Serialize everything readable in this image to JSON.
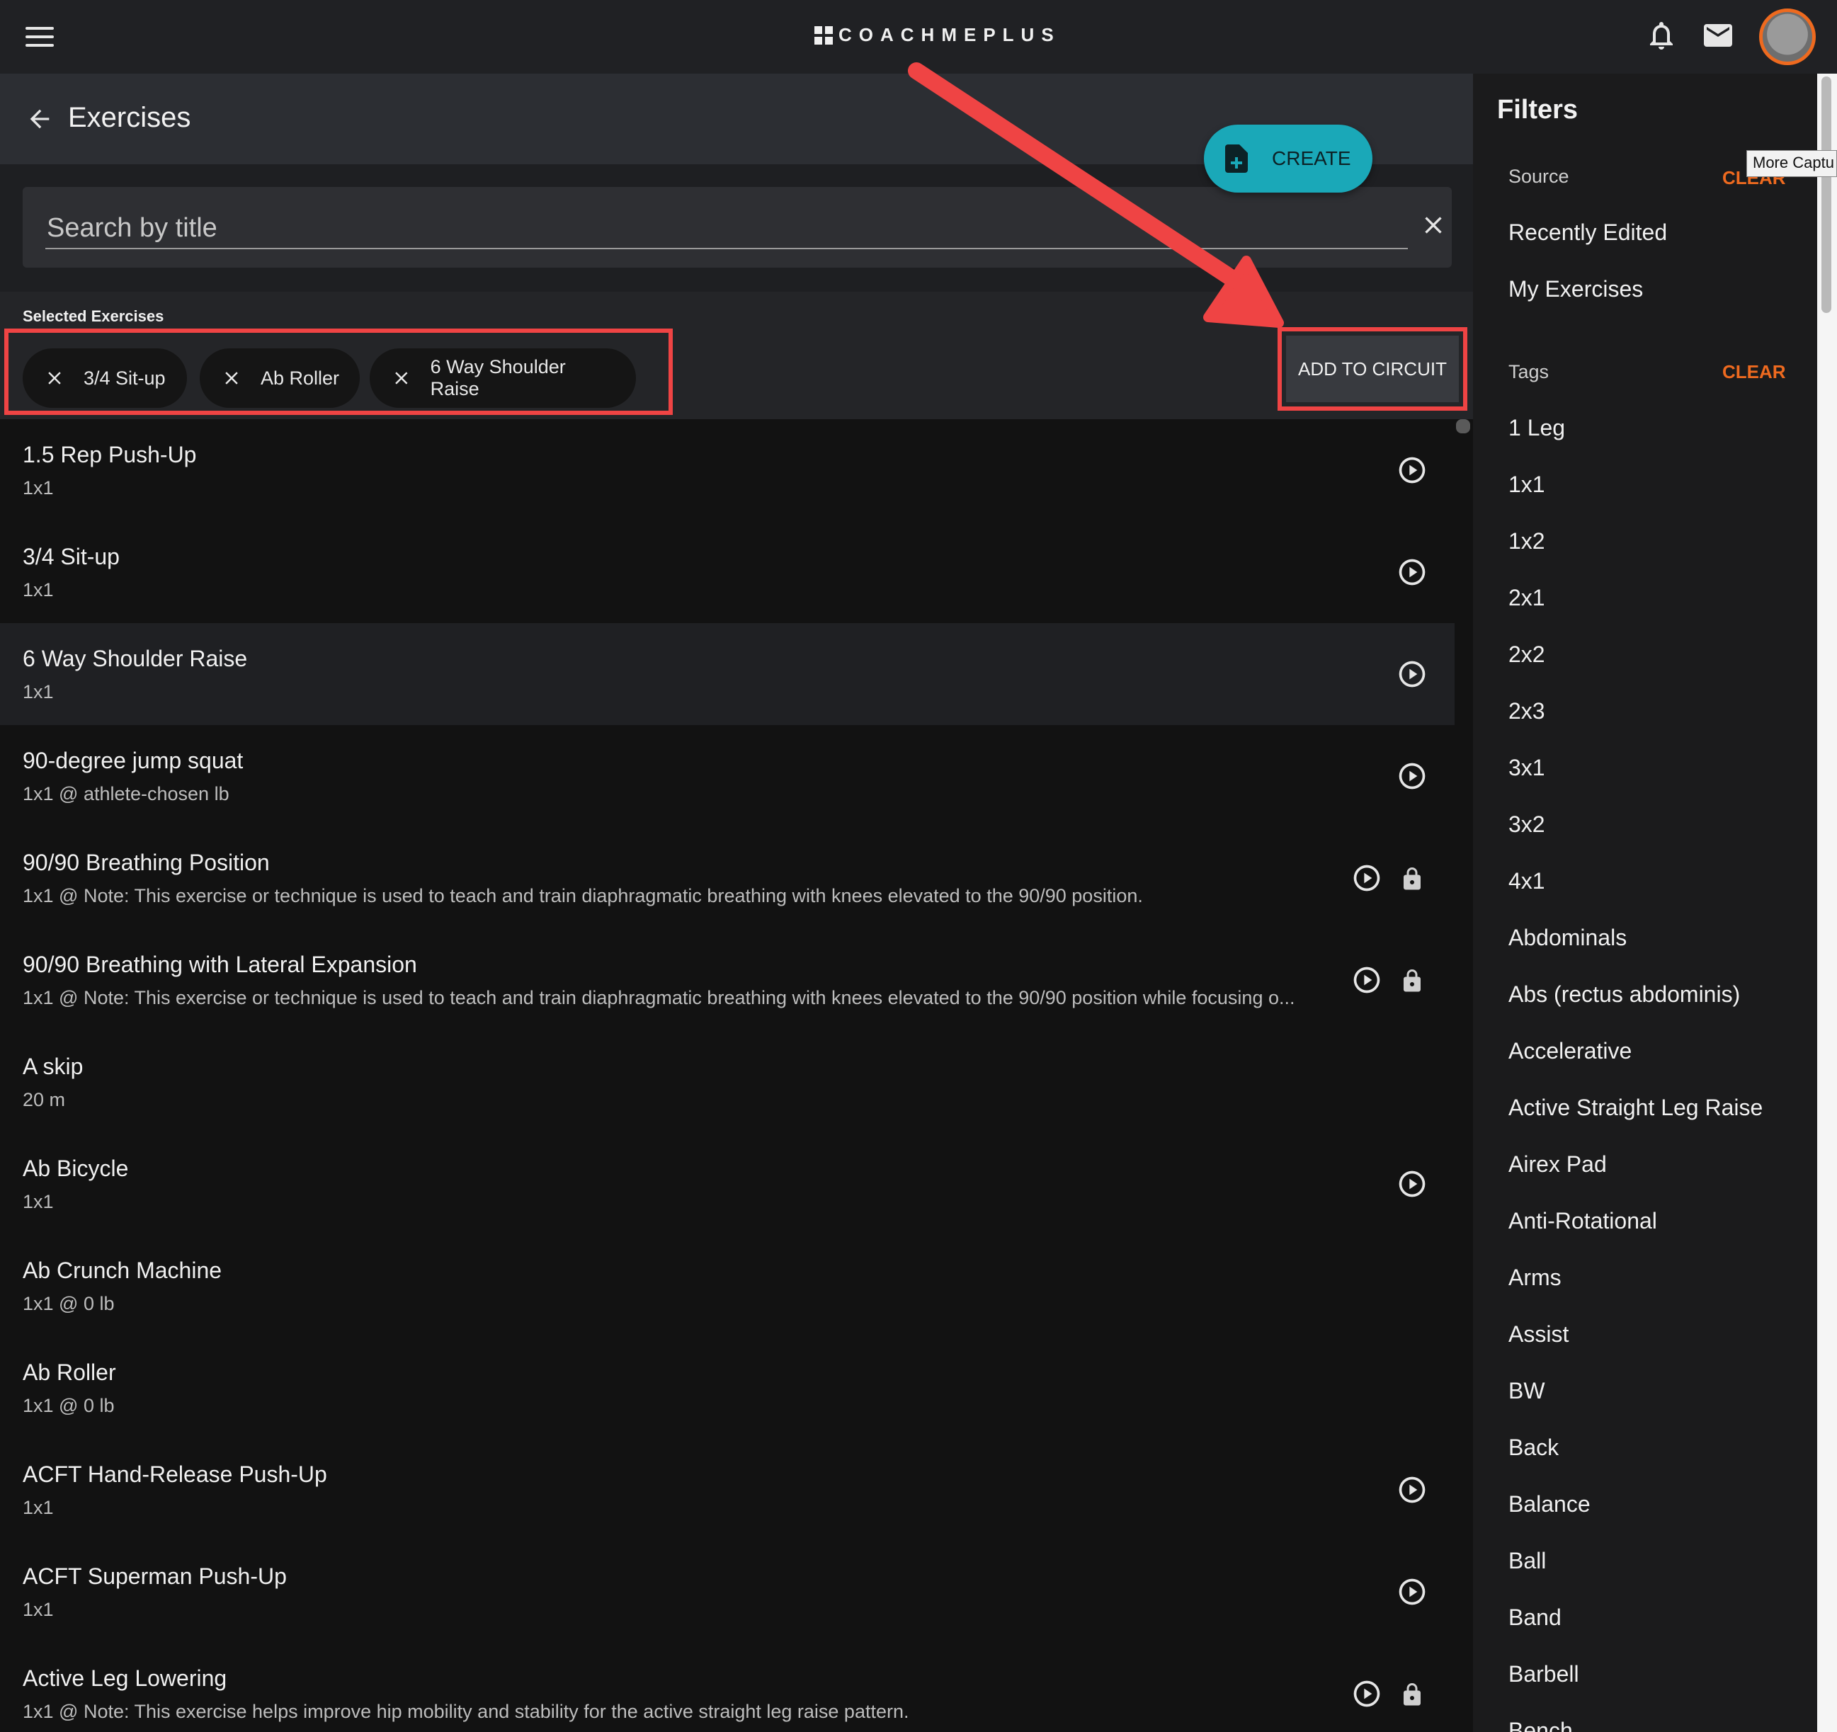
{
  "topbar": {
    "logo_text": "COACHMEPLUS",
    "icons": [
      "menu-icon",
      "bell-icon",
      "mail-icon",
      "avatar"
    ]
  },
  "header": {
    "title": "Exercises"
  },
  "create_button": {
    "label": "CREATE"
  },
  "search": {
    "placeholder": "Search by title",
    "value": ""
  },
  "selected": {
    "label": "Selected Exercises",
    "chips": [
      "3/4 Sit-up",
      "Ab Roller",
      "6 Way Shoulder Raise"
    ],
    "add_button": "ADD TO CIRCUIT"
  },
  "exercises": [
    {
      "title": "1.5 Rep Push-Up",
      "sub": "1x1",
      "video": true,
      "locked": false
    },
    {
      "title": "3/4 Sit-up",
      "sub": "1x1",
      "video": true,
      "locked": false
    },
    {
      "title": "6 Way Shoulder Raise",
      "sub": "1x1",
      "video": true,
      "locked": false,
      "highlight": true
    },
    {
      "title": "90-degree jump squat",
      "sub": "1x1 @ athlete-chosen lb",
      "video": true,
      "locked": false
    },
    {
      "title": "90/90 Breathing Position",
      "sub": "1x1 @ Note: This exercise or technique is used to teach and train diaphragmatic breathing with knees elevated to the 90/90 position.",
      "video": true,
      "locked": true
    },
    {
      "title": "90/90 Breathing with Lateral Expansion",
      "sub": "1x1 @ Note: This exercise or technique is used to teach and train diaphragmatic breathing with knees elevated to the 90/90 position while focusing o...",
      "video": true,
      "locked": true
    },
    {
      "title": "A skip",
      "sub": "20 m",
      "video": false,
      "locked": false
    },
    {
      "title": "Ab Bicycle",
      "sub": "1x1",
      "video": true,
      "locked": false
    },
    {
      "title": "Ab Crunch Machine",
      "sub": "1x1 @ 0 lb",
      "video": false,
      "locked": false
    },
    {
      "title": "Ab Roller",
      "sub": "1x1 @ 0 lb",
      "video": false,
      "locked": false
    },
    {
      "title": "ACFT Hand-Release Push-Up",
      "sub": "1x1",
      "video": true,
      "locked": false
    },
    {
      "title": "ACFT Superman Push-Up",
      "sub": "1x1",
      "video": true,
      "locked": false
    },
    {
      "title": "Active Leg Lowering",
      "sub": "1x1 @ Note: This exercise helps improve hip mobility and stability for the active straight leg raise pattern.",
      "video": true,
      "locked": true
    }
  ],
  "filters": {
    "title": "Filters",
    "source_label": "Source",
    "source_clear": "CLEAR",
    "source_items": [
      "Recently Edited",
      "My Exercises"
    ],
    "tags_label": "Tags",
    "tags_clear": "CLEAR",
    "tags": [
      "1 Leg",
      "1x1",
      "1x2",
      "2x1",
      "2x2",
      "2x3",
      "3x1",
      "3x2",
      "4x1",
      "Abdominals",
      "Abs (rectus abdominis)",
      "Accelerative",
      "Active Straight Leg Raise",
      "Airex Pad",
      "Anti-Rotational",
      "Arms",
      "Assist",
      "BW",
      "Back",
      "Balance",
      "Ball",
      "Band",
      "Barbell",
      "Bench"
    ]
  },
  "tooltip": "More Captu",
  "colors": {
    "accent_teal": "#1aa8b8",
    "clear_orange": "#ee6a1f",
    "annotation_red": "#ef4444"
  }
}
